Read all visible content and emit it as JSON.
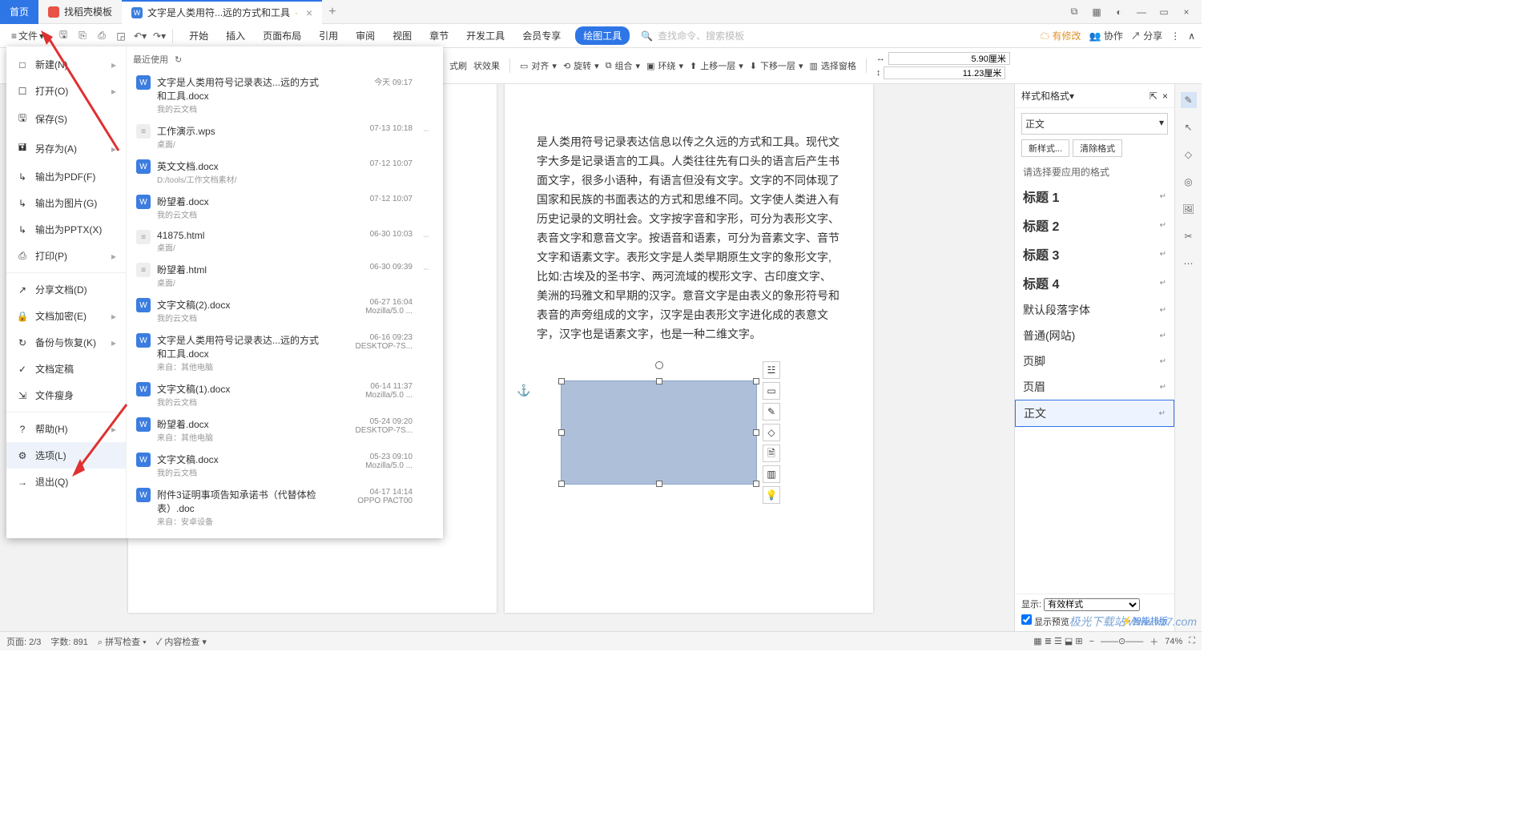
{
  "titlebar": {
    "home_tab": "首页",
    "template_tab": "找稻壳模板",
    "doc_tab": "文字是人类用符...远的方式和工具",
    "doc_modified": "·"
  },
  "menubar": {
    "file_label": "文件",
    "tabs": [
      "开始",
      "插入",
      "页面布局",
      "引用",
      "审阅",
      "视图",
      "章节",
      "开发工具",
      "会员专享",
      "绘图工具"
    ],
    "search_placeholder": "查找命令、搜索模板",
    "right": {
      "unsaved": "有修改",
      "coop": "协作",
      "share": "分享"
    }
  },
  "ribbon": {
    "styleBrush": "式刷",
    "shapeEffect": "状效果",
    "align": "对齐",
    "rotate": "旋转",
    "group": "组合",
    "wrap": "环绕",
    "up": "上移一层",
    "down": "下移一层",
    "pane": "选择窗格",
    "width": "5.90厘米",
    "height": "11.23厘米"
  },
  "file_menu": {
    "items": [
      {
        "label": "新建(N)",
        "arrow": true,
        "icon": "□"
      },
      {
        "label": "打开(O)",
        "arrow": true,
        "icon": "☐"
      },
      {
        "label": "保存(S)",
        "arrow": false,
        "icon": "🖫"
      },
      {
        "label": "另存为(A)",
        "arrow": true,
        "icon": "🖬"
      },
      {
        "label": "输出为PDF(F)",
        "arrow": false,
        "icon": "↳"
      },
      {
        "label": "输出为图片(G)",
        "arrow": false,
        "icon": "↳"
      },
      {
        "label": "输出为PPTX(X)",
        "arrow": false,
        "icon": "↳"
      },
      {
        "label": "打印(P)",
        "arrow": true,
        "icon": "⎙"
      },
      {
        "label": "分享文档(D)",
        "arrow": false,
        "icon": "↗"
      },
      {
        "label": "文档加密(E)",
        "arrow": true,
        "icon": "🔒"
      },
      {
        "label": "备份与恢复(K)",
        "arrow": true,
        "icon": "↻"
      },
      {
        "label": "文档定稿",
        "arrow": false,
        "icon": "✓"
      },
      {
        "label": "文件瘦身",
        "arrow": false,
        "icon": "⇲"
      },
      {
        "label": "帮助(H)",
        "arrow": true,
        "icon": "?"
      },
      {
        "label": "选项(L)",
        "arrow": false,
        "icon": "⚙",
        "hov": true
      },
      {
        "label": "退出(Q)",
        "arrow": false,
        "icon": "→"
      }
    ],
    "recent_label": "最近使用",
    "recent": [
      {
        "name": "文字是人类用符号记录表达...远的方式和工具.docx",
        "path": "我的云文档",
        "time": "今天 09:17",
        "icon": "w"
      },
      {
        "name": "工作演示.wps",
        "path": "桌面/",
        "time": "07-13 10:18",
        "icon": "h",
        "pin": true
      },
      {
        "name": "英文文档.docx",
        "path": "D:/tools/工作文档素材/",
        "time": "07-12 10:07",
        "icon": "w"
      },
      {
        "name": "盼望着.docx",
        "path": "我的云文档",
        "time": "07-12 10:07",
        "icon": "w"
      },
      {
        "name": "41875.html",
        "path": "桌面/",
        "time": "06-30 10:03",
        "icon": "h",
        "pin": true
      },
      {
        "name": "盼望着.html",
        "path": "桌面/",
        "time": "06-30 09:39",
        "icon": "h",
        "pin": true
      },
      {
        "name": "文字文稿(2).docx",
        "path": "我的云文档",
        "time": "06-27 16:04",
        "time2": "Mozilla/5.0 ...",
        "icon": "w"
      },
      {
        "name": "文字是人类用符号记录表达...远的方式和工具.docx",
        "path": "来自：其他电脑",
        "time": "06-16 09:23",
        "time2": "DESKTOP-7S...",
        "icon": "w"
      },
      {
        "name": "文字文稿(1).docx",
        "path": "我的云文档",
        "time": "06-14 11:37",
        "time2": "Mozilla/5.0 ...",
        "icon": "w"
      },
      {
        "name": "盼望着.docx",
        "path": "来自：其他电脑",
        "time": "05-24 09:20",
        "time2": "DESKTOP-7S...",
        "icon": "w"
      },
      {
        "name": "文字文稿.docx",
        "path": "我的云文档",
        "time": "05-23 09:10",
        "time2": "Mozilla/5.0 ...",
        "icon": "w"
      },
      {
        "name": "附件3证明事项告知承诺书（代替体检表）.doc",
        "path": "来自：安卓设备",
        "time": "04-17 14:14",
        "time2": "OPPO PACT00",
        "icon": "w"
      }
    ]
  },
  "doc_text": "是人类用符号记录表达信息以传之久远的方式和工具。现代文字大多是记录语言的工具。人类往往先有口头的语言后产生书面文字，很多小语种，有语言但没有文字。文字的不同体现了国家和民族的书面表达的方式和思维不同。文字使人类进入有历史记录的文明社会。文字按字音和字形，可分为表形文字、表音文字和意音文字。按语音和语素，可分为音素文字、音节文字和语素文字。表形文字是人类早期原生文字的象形文字,比如:古埃及的圣书字、两河流域的楔形文字、古印度文字、美洲的玛雅文和早期的汉字。意音文字是由表义的象形符号和表音的声旁组成的文字，汉字是由表形文字进化成的表意文字，汉字也是语素文字，也是一种二维文字。",
  "rpanel": {
    "title": "样式和格式",
    "current": "正文",
    "new_style": "新样式...",
    "clear": "清除格式",
    "hint": "请选择要应用的格式",
    "styles": [
      {
        "name": "标题 1",
        "bold": true
      },
      {
        "name": "标题 2",
        "bold": true
      },
      {
        "name": "标题 3",
        "bold": true
      },
      {
        "name": "标题 4",
        "bold": true
      },
      {
        "name": "默认段落字体"
      },
      {
        "name": "普通(网站)"
      },
      {
        "name": "页脚"
      },
      {
        "name": "页眉"
      },
      {
        "name": "正文",
        "sel": true
      }
    ],
    "show_label": "显示:",
    "show_val": "有效样式",
    "preview": "显示预览"
  },
  "status": {
    "page": "页面: 2/3",
    "words": "字数: 891",
    "spell": "拼写检查",
    "content": "内容检查",
    "zoom": "74%",
    "smart": "智能排版"
  },
  "watermark": "极光下载站\nwww.xz7.com"
}
